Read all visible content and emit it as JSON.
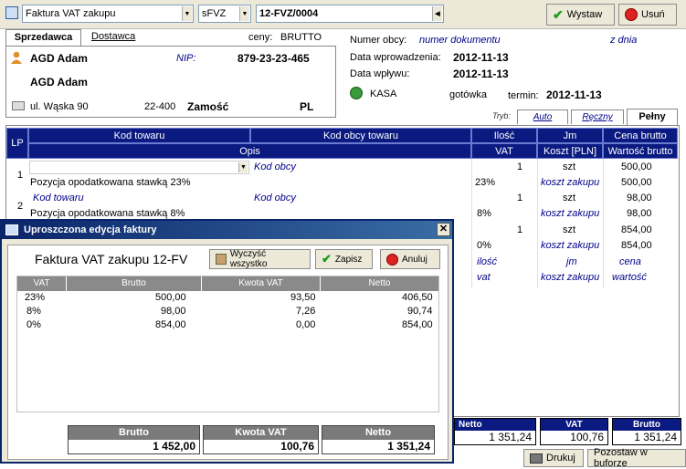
{
  "toolbar": {
    "doc_type": "Faktura VAT zakupu",
    "series": "sFVZ",
    "number": "12-FVZ/0004",
    "issue_label": "Wystaw",
    "cancel_label": "Usuń"
  },
  "seller": {
    "tab_seller": "Sprzedawca",
    "tab_delivery": "Dostawca",
    "prices_label": "ceny:",
    "prices_value": "BRUTTO",
    "name1": "AGD Adam",
    "nip_label": "NIP:",
    "nip": "879-23-23-465",
    "name2": "AGD Adam",
    "street": "ul. Wąska 90",
    "postcode": "22-400",
    "city": "Zamość",
    "country": "PL"
  },
  "docinfo": {
    "foreign_no_label": "Numer obcy:",
    "foreign_no_value": "numer dokumentu",
    "date_suffix": "z dnia",
    "entry_date_label": "Data wprowadzenia:",
    "entry_date": "2012-11-13",
    "inflow_date_label": "Data wpływu:",
    "inflow_date": "2012-11-13",
    "cash": "KASA",
    "payment": "gotówka",
    "term_label": "termin:",
    "term": "2012-11-13"
  },
  "mode": {
    "label": "Tryb:",
    "tabs": [
      "Auto",
      "Ręczny",
      "Pełny"
    ]
  },
  "grid": {
    "headers": {
      "lp": "LP",
      "code": "Kod towaru",
      "foreign_code": "Kod obcy towaru",
      "qty": "Ilość",
      "unit": "Jm",
      "price": "Cena brutto",
      "desc": "Opis",
      "vat": "VAT",
      "cost": "Koszt [PLN]",
      "value": "Wartość brutto"
    },
    "rows": [
      {
        "lp": "1",
        "code": "",
        "foreign": "Kod obcy",
        "qty": "1",
        "unit": "szt",
        "price": "500,00",
        "desc": "Pozycja opodatkowana stawką 23%",
        "vat": "23%",
        "cost": "koszt zakupu",
        "value": "500,00"
      },
      {
        "lp": "2",
        "code": "Kod towaru",
        "foreign": "Kod obcy",
        "qty": "1",
        "unit": "szt",
        "price": "98,00",
        "desc": "Pozycja opodatkowana stawką  8%",
        "vat": "8%",
        "cost": "koszt zakupu",
        "value": "98,00"
      },
      {
        "lp": "",
        "code": "",
        "foreign": "",
        "qty": "1",
        "unit": "szt",
        "price": "854,00",
        "desc": "",
        "vat": "0%",
        "cost": "koszt zakupu",
        "value": "854,00"
      },
      {
        "lp": "",
        "code": "",
        "foreign": "",
        "qty": "ilość",
        "unit": "jm",
        "price": "cena",
        "desc": "",
        "vat": "vat",
        "cost": "koszt zakupu",
        "value": "wartość"
      }
    ]
  },
  "totals": {
    "net_label": "Netto",
    "net": "1 351,24",
    "vat_label": "VAT",
    "vat": "100,76",
    "gross_label": "Brutto",
    "gross": "1 351,24"
  },
  "bottom": {
    "print_label": "Drukuj",
    "keep_label": "Pozostaw w buforze"
  },
  "dialog": {
    "title": "Uproszczona edycja faktury",
    "heading": "Faktura VAT zakupu 12-FV",
    "clear_label": "Wyczyść wszystko",
    "save_label": "Zapisz",
    "cancel_label": "Anuluj",
    "columns": [
      "VAT",
      "Brutto",
      "Kwota VAT",
      "Netto"
    ],
    "rows": [
      [
        "23%",
        "500,00",
        "93,50",
        "406,50"
      ],
      [
        "8%",
        "98,00",
        "7,26",
        "90,74"
      ],
      [
        "0%",
        "854,00",
        "0,00",
        "854,00"
      ]
    ],
    "sum_gross_label": "Brutto",
    "sum_gross": "1 452,00",
    "sum_vat_label": "Kwota VAT",
    "sum_vat": "100,76",
    "sum_net_label": "Netto",
    "sum_net": "1 351,24"
  }
}
